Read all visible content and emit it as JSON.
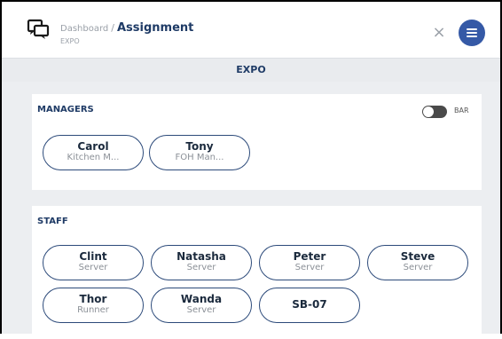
{
  "header": {
    "breadcrumb_link": "Dashboard",
    "breadcrumb_separator": "/",
    "breadcrumb_current": "Assignment",
    "subtitle": "EXPO",
    "close_label": "×"
  },
  "section_bar": {
    "title": "EXPO"
  },
  "managers": {
    "title": "MANAGERS",
    "toggle_label": "BAR",
    "people": [
      {
        "name": "Carol",
        "role": "Kitchen M..."
      },
      {
        "name": "Tony",
        "role": "FOH Man..."
      }
    ]
  },
  "staff": {
    "title": "STAFF",
    "people": [
      {
        "name": "Clint",
        "role": "Server"
      },
      {
        "name": "Natasha",
        "role": "Server"
      },
      {
        "name": "Peter",
        "role": "Server"
      },
      {
        "name": "Steve",
        "role": "Server"
      },
      {
        "name": "Thor",
        "role": "Runner"
      },
      {
        "name": "Wanda",
        "role": "Server"
      },
      {
        "name": "SB-07",
        "role": ""
      }
    ]
  },
  "colors": {
    "accent": "#3559a6",
    "heading": "#1f3b66",
    "pill_border": "#2c4a7a"
  },
  "icons": {
    "app": "chat-bubbles-icon",
    "close": "close-icon",
    "menu": "menu-icon"
  }
}
